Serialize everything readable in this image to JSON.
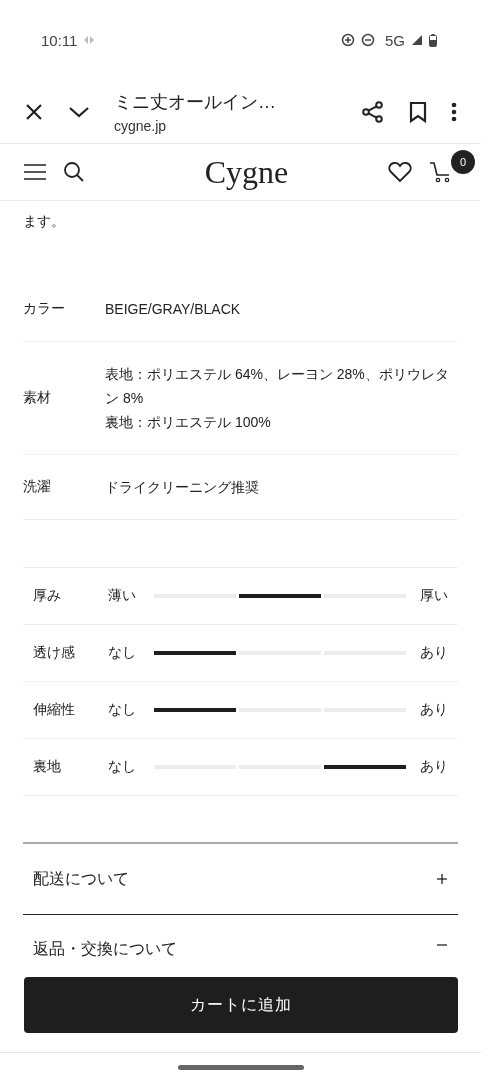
{
  "status_bar": {
    "time": "10:11",
    "network": "5G"
  },
  "browser": {
    "title": "ミニ丈オールイン…",
    "url": "cygne.jp"
  },
  "site_header": {
    "logo": "Cygne",
    "cart_count": "0"
  },
  "intro_tail": "ます。",
  "specs": [
    {
      "label": "カラー",
      "lines": [
        "BEIGE/GRAY/BLACK"
      ]
    },
    {
      "label": "素材",
      "lines": [
        "表地：ポリエステル 64%、レーヨン 28%、ポリウレタン 8%",
        "裏地：ポリエステル 100%"
      ]
    },
    {
      "label": "洗濯",
      "lines": [
        "ドライクリーニング推奨"
      ]
    }
  ],
  "scales": [
    {
      "label": "厚み",
      "low": "薄い",
      "high": "厚い",
      "segments": [
        {
          "selected": false
        },
        {
          "selected": true
        },
        {
          "selected": false
        }
      ]
    },
    {
      "label": "透け感",
      "low": "なし",
      "high": "あり",
      "segments": [
        {
          "selected": true
        },
        {
          "selected": false
        },
        {
          "selected": false
        }
      ]
    },
    {
      "label": "伸縮性",
      "low": "なし",
      "high": "あり",
      "segments": [
        {
          "selected": true
        },
        {
          "selected": false
        },
        {
          "selected": false
        }
      ]
    },
    {
      "label": "裏地",
      "low": "なし",
      "high": "あり",
      "segments": [
        {
          "selected": false
        },
        {
          "selected": false
        },
        {
          "selected": true
        }
      ]
    }
  ],
  "accordions": [
    {
      "title": "配送について",
      "expanded": false
    },
    {
      "title": "返品・交換について",
      "expanded": true
    }
  ],
  "add_to_cart": "カートに追加"
}
